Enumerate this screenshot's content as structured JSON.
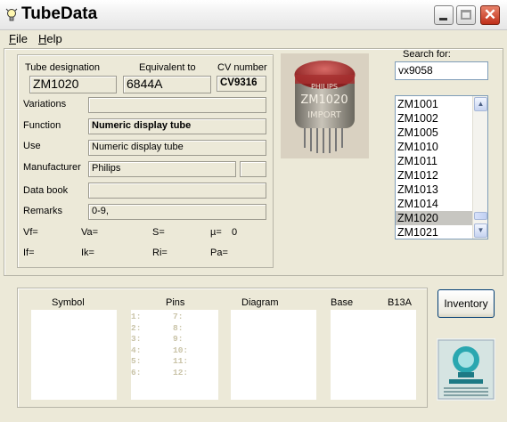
{
  "window": {
    "title": "TubeData"
  },
  "menu": {
    "file": "File",
    "file_accel": "F",
    "file_rest": "ile",
    "help": "Help",
    "help_accel": "H",
    "help_rest": "elp"
  },
  "search": {
    "label": "Search for:",
    "value": "vx9058"
  },
  "tube_list": {
    "items": [
      "ZM1001",
      "ZM1002",
      "ZM1005",
      "ZM1010",
      "ZM1011",
      "ZM1012",
      "ZM1013",
      "ZM1014",
      "ZM1020",
      "ZM1021"
    ],
    "selected": "ZM1020"
  },
  "details": {
    "designation_label": "Tube designation",
    "designation": "ZM1020",
    "equivalent_label": "Equivalent to",
    "equivalent": "6844A",
    "cv_label": "CV number",
    "cv": "CV9316",
    "variations_label": "Variations",
    "variations": "",
    "function_label": "Function",
    "function": "Numeric display tube",
    "use_label": "Use",
    "use": "Numeric display tube",
    "manufacturer_label": "Manufacturer",
    "manufacturer": "Philips",
    "manufacturer_extra": "",
    "databook_label": "Data book",
    "databook": "",
    "remarks_label": "Remarks",
    "remarks": "0-9,"
  },
  "params": {
    "vf": "Vf=",
    "va": "Va=",
    "s": "S=",
    "mu": "µ=",
    "mu_value": "0",
    "if": "If=",
    "ik": "Ik=",
    "ri": "Ri=",
    "pa": "Pa="
  },
  "bottom": {
    "symbol_label": "Symbol",
    "pins_label": "Pins",
    "diagram_label": "Diagram",
    "base_label": "Base",
    "base_value": "B13A",
    "pins_left": [
      "1:",
      "2:",
      "3:",
      "4:",
      "5:",
      "6:"
    ],
    "pins_right": [
      "7:",
      "8:",
      "9:",
      "10:",
      "11:",
      "12:"
    ]
  },
  "buttons": {
    "inventory": "Inventory"
  },
  "photo": {
    "brand_text": "PHILIPS",
    "model_text": "ZM1020",
    "import_text": "IMPORT"
  },
  "colors": {
    "list_selected": "#c7c6c1",
    "close_button": "#c0301a",
    "window_bg": "#ece9d8"
  },
  "icons": {
    "app": "lightbulb-icon",
    "minimize": "minimize-icon",
    "maximize": "maximize-icon",
    "close": "close-icon"
  }
}
